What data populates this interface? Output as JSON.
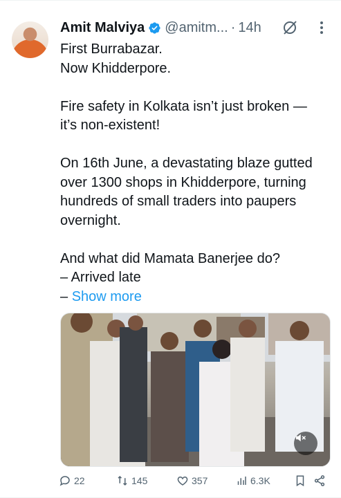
{
  "tweet": {
    "author": {
      "name": "Amit Malviya",
      "handle": "@amitm...",
      "time": "14h"
    },
    "lines": [
      "First Burrabazar.",
      "Now Khidderpore.",
      "",
      "Fire safety in Kolkata isn’t just broken —",
      "it’s non-existent!",
      "",
      "On 16th June, a devastating blaze gutted",
      "over 1300 shops in Khidderpore, turning",
      "hundreds of small traders into paupers",
      "overnight.",
      "",
      "And what did Mamata Banerjee do?",
      "– Arrived late"
    ],
    "last_line_prefix": "– ",
    "show_more": "Show more"
  },
  "actions": {
    "replies": "22",
    "reposts": "145",
    "likes": "357",
    "views": "6.3K"
  },
  "colors": {
    "text": "#0f1419",
    "secondary": "#536471",
    "link": "#1d9bf0",
    "verified": "#1d9bf0"
  }
}
